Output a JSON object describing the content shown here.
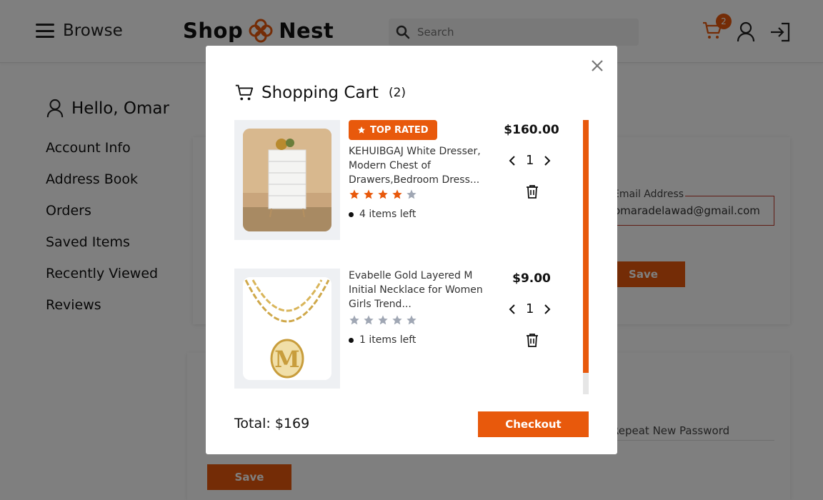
{
  "header": {
    "browse_label": "Browse",
    "logo_part1": "Shop",
    "logo_part2": "Nest",
    "search_placeholder": "Search",
    "cart_count": "2"
  },
  "sidebar": {
    "greeting": "Hello, Omar",
    "items": [
      {
        "label": "Account Info"
      },
      {
        "label": "Address Book"
      },
      {
        "label": "Orders"
      },
      {
        "label": "Saved Items"
      },
      {
        "label": "Recently Viewed"
      },
      {
        "label": "Reviews"
      }
    ]
  },
  "account": {
    "email_label": "Email Address",
    "email_value": "omaradelawad@gmail.com",
    "save_label": "Save",
    "repeat_password_label": "Repeat New Password",
    "save2_label": "Save"
  },
  "cart_modal": {
    "title": "Shopping Cart",
    "count": "(2)",
    "items": [
      {
        "badge": "TOP RATED",
        "name_line1": "KEHUIBGAJ White Dresser,",
        "name_line2": "Modern Chest of",
        "name_line3": "Drawers,Bedroom Dress...",
        "rating": 4,
        "stock": "4 items left",
        "price": "$160.00",
        "quantity": "1"
      },
      {
        "badge": "",
        "name_line1": "Evabelle Gold Layered M",
        "name_line2": "Initial Necklace for Women",
        "name_line3": "Girls Trend...",
        "rating": 0,
        "stock": "1 items left",
        "price": "$9.00",
        "quantity": "1"
      }
    ],
    "total": "Total: $169",
    "checkout_label": "Checkout"
  },
  "colors": {
    "accent": "#e8590c",
    "star_empty": "#a0a7b4",
    "overlay": "rgba(0,0,0,0.5)"
  },
  "icons": [
    "menu-icon",
    "logo-flower-icon",
    "search-icon",
    "cart-icon",
    "user-icon",
    "login-icon",
    "close-icon",
    "star-icon",
    "chevron-left-icon",
    "chevron-right-icon",
    "trash-icon"
  ]
}
